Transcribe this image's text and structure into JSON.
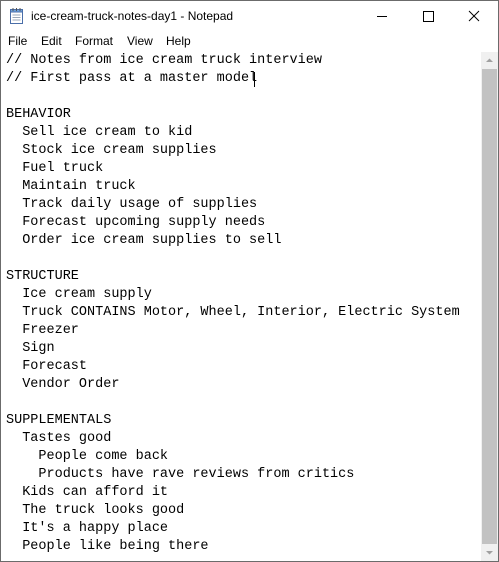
{
  "window": {
    "title": "ice-cream-truck-notes-day1 - Notepad"
  },
  "icons": {
    "app": "notepad-icon",
    "minimize": "minimize-icon",
    "maximize": "maximize-icon",
    "close": "close-icon",
    "scroll_up": "scroll-up-icon",
    "scroll_down": "scroll-down-icon"
  },
  "menu": {
    "file": "File",
    "edit": "Edit",
    "format": "Format",
    "view": "View",
    "help": "Help"
  },
  "editor": {
    "lines": [
      "// Notes from ice cream truck interview",
      "// First pass at a master model",
      "",
      "BEHAVIOR",
      "  Sell ice cream to kid",
      "  Stock ice cream supplies",
      "  Fuel truck",
      "  Maintain truck",
      "  Track daily usage of supplies",
      "  Forecast upcoming supply needs",
      "  Order ice cream supplies to sell",
      "",
      "STRUCTURE",
      "  Ice cream supply",
      "  Truck CONTAINS Motor, Wheel, Interior, Electric System",
      "  Freezer",
      "  Sign",
      "  Forecast",
      "  Vendor Order",
      "",
      "SUPPLEMENTALS",
      "  Tastes good",
      "    People come back",
      "    Products have rave reviews from critics",
      "  Kids can afford it",
      "  The truck looks good",
      "  It's a happy place",
      "  People like being there"
    ]
  },
  "colors": {
    "window_border": "#6b6b6b",
    "scrollbar_track": "#f0f0f0",
    "scrollbar_thumb": "#c2c2c2",
    "text": "#000000"
  }
}
